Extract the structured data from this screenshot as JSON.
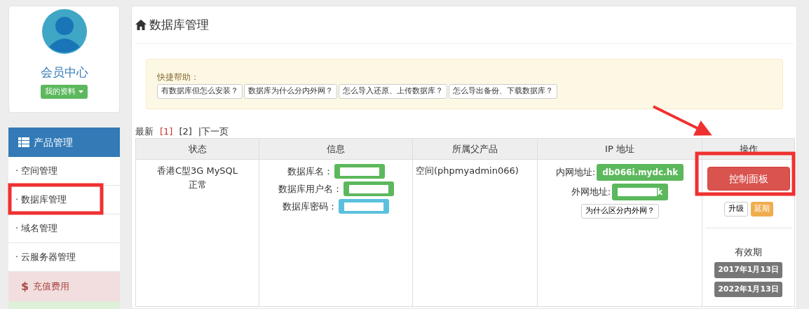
{
  "profile": {
    "title": "会员中心",
    "menu_button": "我的资料"
  },
  "sidebar": {
    "header": "产品管理",
    "items": [
      {
        "label": "· 空间管理"
      },
      {
        "label": "· 数据库管理"
      },
      {
        "label": "· 域名管理"
      },
      {
        "label": "· 云服务器管理"
      }
    ],
    "recharge": {
      "symbol": "$",
      "label": "充值费用"
    }
  },
  "page_title": "数据库管理",
  "help": {
    "title": "快捷帮助：",
    "links": [
      "有数据库但怎么安装？",
      "数据库为什么分内外网？",
      "怎么导入还原、上传数据库？",
      "怎么导出备份、下载数据库？"
    ]
  },
  "pagination": {
    "latest": "最新",
    "pages": [
      {
        "label": "[1]",
        "selected": true
      },
      {
        "label": "[2]",
        "selected": false
      }
    ],
    "next": "|下一页"
  },
  "table": {
    "columns": [
      "状态",
      "信息",
      "所属父产品",
      "IP 地址",
      "操作"
    ],
    "rows": [
      {
        "status": [
          "香港C型3G MySQL",
          "正常"
        ],
        "info": [
          {
            "label": "数据库名：",
            "kind": "success",
            "redacted": true
          },
          {
            "label": "数据库用户名：",
            "kind": "success",
            "redacted": true
          },
          {
            "label": "数据库密码：",
            "kind": "info",
            "redacted": true
          }
        ],
        "parent": "空间(phpmyadmin066)",
        "ip": [
          {
            "label": "内网地址:",
            "value": "db066i.mydc.hk",
            "redacted": false
          },
          {
            "label": "外网地址:",
            "value": "k",
            "redacted": true
          }
        ],
        "ip_help": "为什么区分内外网？",
        "control_panel": "控制面板",
        "upgrade": "升级",
        "extend": "延期",
        "validity_label": "有效期",
        "dates": [
          "2017年1月13日",
          "2022年1月13日"
        ]
      }
    ]
  }
}
